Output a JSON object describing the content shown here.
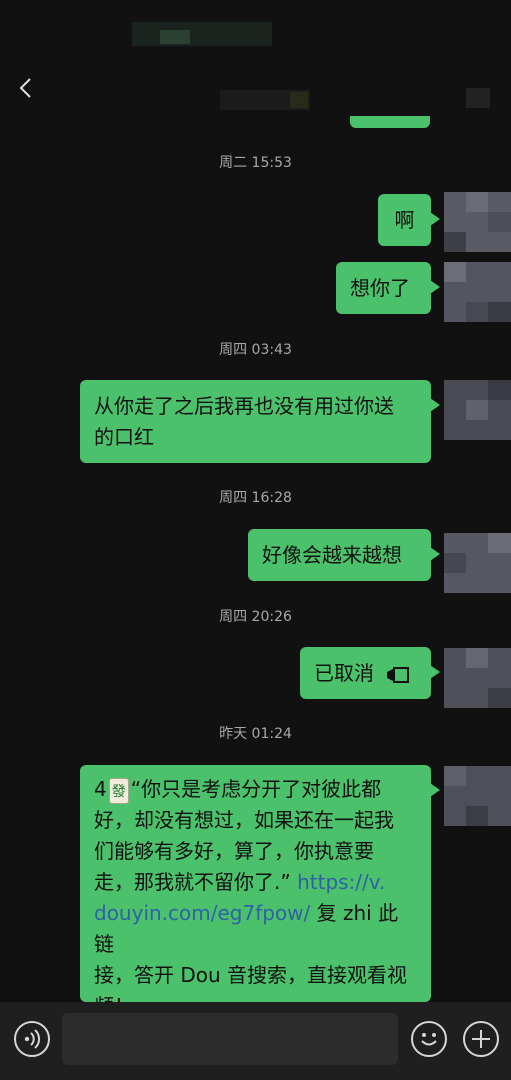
{
  "header": {
    "back_icon": "chevron-left-icon"
  },
  "timestamps": [
    "周二 15:53",
    "周四 03:43",
    "周四 16:28",
    "周四 20:26",
    "昨天 01:24"
  ],
  "messages": [
    {
      "text": "啊"
    },
    {
      "text": "想你了"
    },
    {
      "text_line1": "从你走了之后我再也没有用过你送",
      "text_line2": "的口红"
    },
    {
      "text": "好像会越来越想"
    },
    {
      "text": "已取消",
      "icon": "call-cancelled-icon"
    },
    {
      "lead": "4",
      "tile": "發",
      "line1": "“你只是考虑分开了对彼此都",
      "line2": "好，却没有想过，如果还在一起我",
      "line3": "们能够有多好，算了，你执意要",
      "line4_text": "走，那我就不留你了.”",
      "line4_link": "https://v.",
      "line5_link": "douyin.com/eg7fpow/",
      "line5_text": "复 zhi 此链",
      "line6": "接，答开 Dou 音搜索，直接观看视",
      "line7": "频！"
    }
  ],
  "input_bar": {
    "voice_icon": "voice-icon",
    "emoji_icon": "emoji-icon",
    "plus_icon": "plus-icon",
    "input_value": ""
  },
  "colors": {
    "background": "#111111",
    "bubble": "#4cc16b",
    "link": "#2e62a6",
    "timestamp": "#a8a8a8"
  }
}
